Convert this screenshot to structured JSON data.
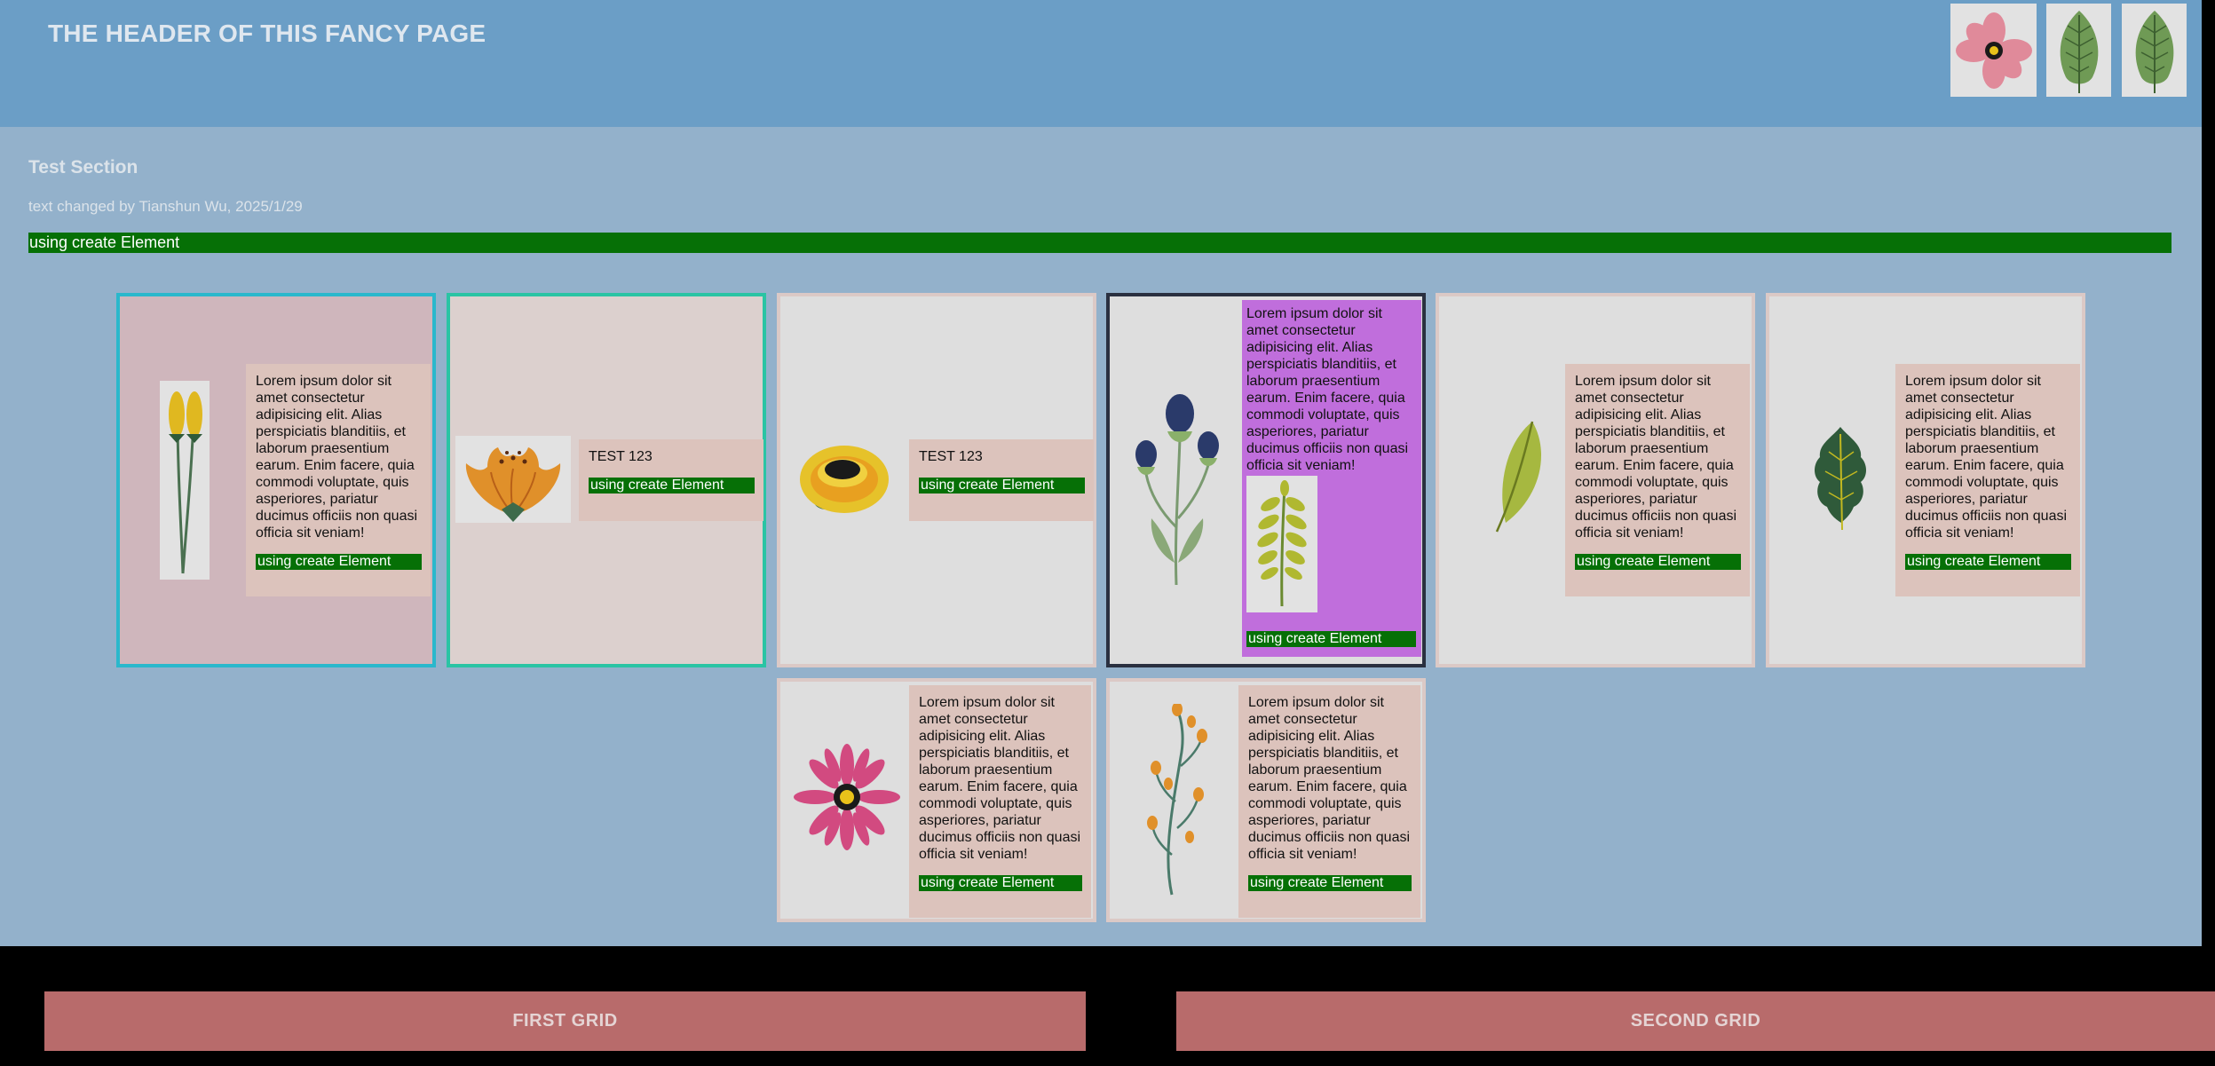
{
  "header": {
    "title": "THE HEADER OF THIS FANCY PAGE"
  },
  "section": {
    "title": "Test Section",
    "subtitle": "text changed by Tianshun Wu, 2025/1/29",
    "bar_text": "using create Element"
  },
  "cards": [
    {
      "text": "Lorem ipsum dolor sit amet consectetur adipisicing elit. Alias perspiciatis blanditiis, et laborum praesentium earum. Enim facere, quia commodi voluptate, quis asperiores, pariatur ducimus officiis non quasi officia sit veniam!",
      "button": "using create Element",
      "image": "yellow-tulips"
    },
    {
      "text": "TEST 123",
      "button": "using create Element",
      "image": "orange-flower"
    },
    {
      "text": "TEST 123",
      "button": "using create Element",
      "image": "yellow-flower-top"
    },
    {
      "text": "Lorem ipsum dolor sit amet consectetur adipisicing elit. Alias perspiciatis blanditiis, et laborum praesentium earum. Enim facere, quia commodi voluptate, quis asperiores, pariatur ducimus officiis non quasi officia sit veniam!",
      "button": "using create Element",
      "image": "thistle",
      "image2": "fern-leaf"
    },
    {
      "text": "Lorem ipsum dolor sit amet consectetur adipisicing elit. Alias perspiciatis blanditiis, et laborum praesentium earum. Enim facere, quia commodi voluptate, quis asperiores, pariatur ducimus officiis non quasi officia sit veniam!",
      "button": "using create Element",
      "image": "green-leaf"
    },
    {
      "text": "Lorem ipsum dolor sit amet consectetur adipisicing elit. Alias perspiciatis blanditiis, et laborum praesentium earum. Enim facere, quia commodi voluptate, quis asperiores, pariatur ducimus officiis non quasi officia sit veniam!",
      "button": "using create Element",
      "image": "dark-leaf"
    },
    {
      "text": "Lorem ipsum dolor sit amet consectetur adipisicing elit. Alias perspiciatis blanditiis, et laborum praesentium earum. Enim facere, quia commodi voluptate, quis asperiores, pariatur ducimus officiis non quasi officia sit veniam!",
      "button": "using create Element",
      "image": "pink-daisy"
    },
    {
      "text": "Lorem ipsum dolor sit amet consectetur adipisicing elit. Alias perspiciatis blanditiis, et laborum praesentium earum. Enim facere, quia commodi voluptate, quis asperiores, pariatur ducimus officiis non quasi officia sit veniam!",
      "button": "using create Element",
      "image": "berry-branch"
    }
  ],
  "buttons": {
    "first": "FIRST GRID",
    "second": "SECOND GRID"
  },
  "header_images": [
    "pink-flower",
    "green-leaf",
    "green-leaf"
  ]
}
